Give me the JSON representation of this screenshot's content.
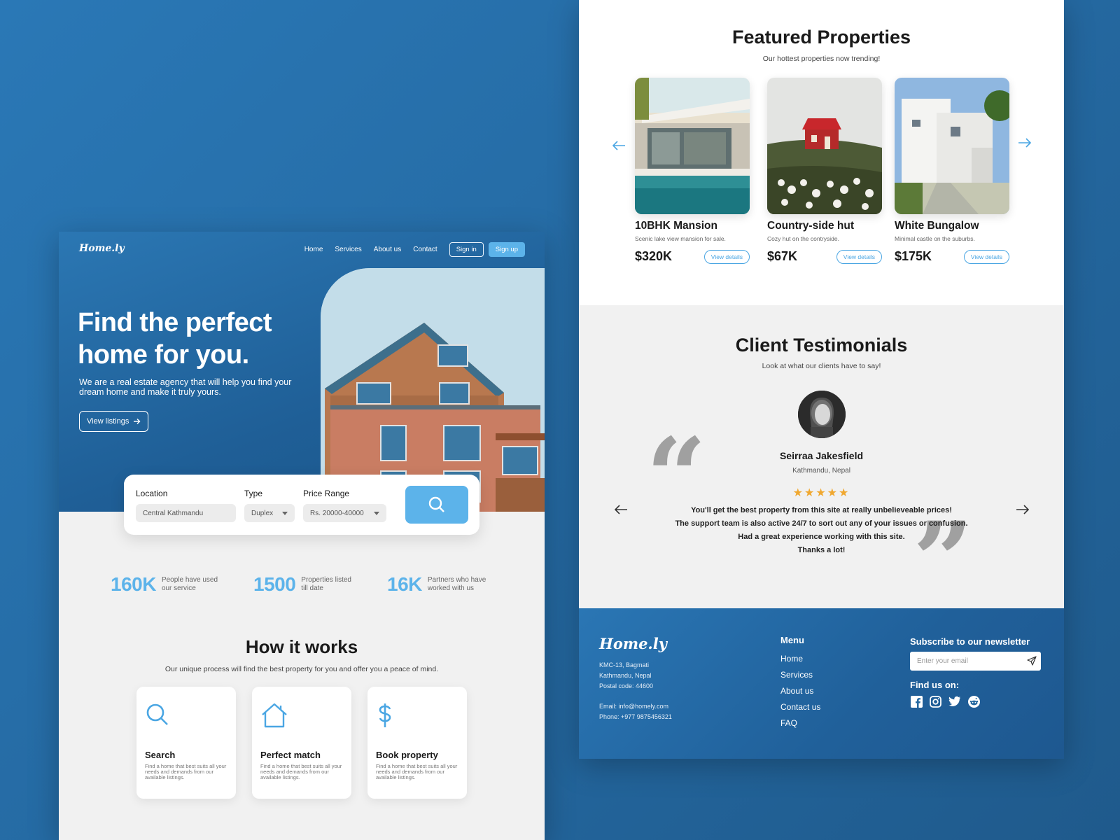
{
  "left": {
    "brand": "Home.ly",
    "nav": {
      "links": [
        "Home",
        "Services",
        "About us",
        "Contact"
      ],
      "signin": "Sign in",
      "signup": "Sign up"
    },
    "hero": {
      "title": "Find the perfect home for you.",
      "subtitle": "We are a real estate agency that will help you find your dream home and make it truly yours.",
      "cta": "View listings"
    },
    "search": {
      "location_label": "Location",
      "location_value": "Central Kathmandu",
      "type_label": "Type",
      "type_value": "Duplex",
      "price_label": "Price Range",
      "price_value": "Rs. 20000-40000"
    },
    "stats": [
      {
        "value": "160K",
        "text": "People  have used our service"
      },
      {
        "value": "1500",
        "text": "Properties listed till date"
      },
      {
        "value": "16K",
        "text": "Partners who have worked with us"
      }
    ],
    "how": {
      "title": "How it works",
      "subtitle": "Our unique process  will find the best property for you and offer you a peace of mind.",
      "cards": [
        {
          "title": "Search",
          "desc": "Find a home that best suits all your needs and demands from our available listings.",
          "icon": "search-icon"
        },
        {
          "title": "Perfect match",
          "desc": "Find a home that best suits all your needs and demands from our available listings.",
          "icon": "house-icon"
        },
        {
          "title": "Book property",
          "desc": "Find a home that best suits all your needs and demands from our available listings.",
          "icon": "dollar-icon"
        }
      ]
    }
  },
  "right": {
    "featured": {
      "title": "Featured Properties",
      "subtitle": "Our hottest properties now trending!",
      "properties": [
        {
          "name": "10BHK Mansion",
          "desc": "Scenic lake view mansion for sale.",
          "price": "$320K",
          "cta": "View details"
        },
        {
          "name": "Country-side hut",
          "desc": "Cozy hut on the contryside.",
          "price": "$67K",
          "cta": "View details"
        },
        {
          "name": "White Bungalow",
          "desc": "Minimal castle on the suburbs.",
          "price": "$175K",
          "cta": "View details"
        }
      ]
    },
    "testimonials": {
      "title": "Client Testimonials",
      "subtitle": "Look at what our clients have to say!",
      "name": "Seirraa Jakesfield",
      "location": "Kathmandu, Nepal",
      "rating": 5,
      "stars": "★★★★★",
      "quote": [
        "You'll get the best property from this site at really unbelieveable prices!",
        "The support team is also active 24/7 to sort out any of your issues or confusion.",
        "Had a great experience working with this site.",
        "Thanks a lot!"
      ]
    },
    "footer": {
      "brand": "Home.ly",
      "address": [
        "KMC-13, Bagmati",
        "Kathmandu, Nepal",
        "Postal code: 44600"
      ],
      "email": "Email: info@homely.com",
      "phone": "Phone: +977 9875456321",
      "menu_title": "Menu",
      "menu": [
        "Home",
        "Services",
        "About us",
        "Contact us",
        "FAQ"
      ],
      "newsletter_title": "Subscribe to  our newsletter",
      "newsletter_placeholder": "Enter your email",
      "find_us": "Find us on:",
      "socials": [
        "facebook-icon",
        "instagram-icon",
        "twitter-icon",
        "reddit-icon"
      ]
    }
  },
  "colors": {
    "accent": "#5cb3ea",
    "brand_blue": "#2468a0",
    "star": "#f0a830"
  }
}
